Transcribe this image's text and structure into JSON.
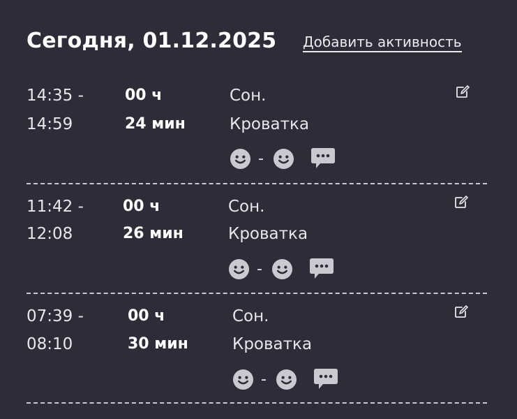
{
  "header": {
    "title": "Сегодня, 01.12.2025",
    "add_link": "Добавить активность"
  },
  "entries": [
    {
      "start": "14:35 -",
      "end": "14:59",
      "hours": "00 ч",
      "minutes": "24 мин",
      "type": "Сон.",
      "place": "Кроватка",
      "separator": "-"
    },
    {
      "start": "11:42 -",
      "end": "12:08",
      "hours": "00 ч",
      "minutes": "26 мин",
      "type": "Сон.",
      "place": "Кроватка",
      "separator": "-"
    },
    {
      "start": "07:39 -",
      "end": "08:10",
      "hours": "00 ч",
      "minutes": "30 мин",
      "type": "Сон.",
      "place": "Кроватка",
      "separator": "-"
    }
  ],
  "icons": {
    "mood": "smile-icon",
    "comment": "comment-icon",
    "edit": "edit-icon"
  },
  "colors": {
    "background": "#2d2d39",
    "text": "#ffffff",
    "icon": "#c9c9d0"
  }
}
